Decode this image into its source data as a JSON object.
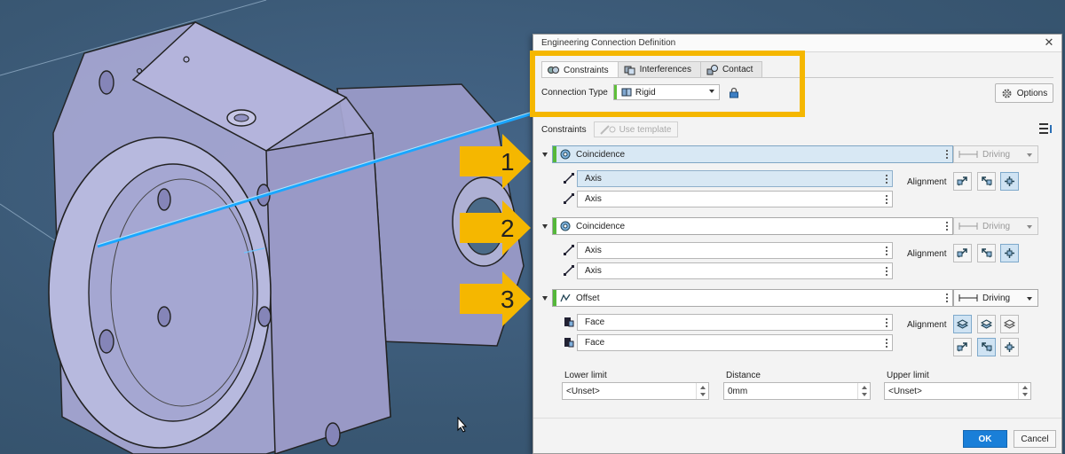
{
  "dialog": {
    "title": "Engineering Connection Definition",
    "close_glyph": "✕",
    "tabs": [
      {
        "label": "Constraints",
        "icon": "constraints-icon",
        "active": true
      },
      {
        "label": "Interferences",
        "icon": "interferences-icon",
        "active": false
      },
      {
        "label": "Contact",
        "icon": "contact-icon",
        "active": false
      }
    ],
    "connection_type_label": "Connection Type",
    "connection_type_value": "Rigid",
    "options_label": "Options",
    "constraints_label": "Constraints",
    "use_template_label": "Use template",
    "constraints": [
      {
        "type": "Coincidence",
        "driving": "Driving",
        "driving_enabled": false,
        "geometry": [
          "Axis",
          "Axis"
        ],
        "alignment_label": "Alignment"
      },
      {
        "type": "Coincidence",
        "driving": "Driving",
        "driving_enabled": false,
        "geometry": [
          "Axis",
          "Axis"
        ],
        "alignment_label": "Alignment"
      },
      {
        "type": "Offset",
        "driving": "Driving",
        "driving_enabled": true,
        "geometry": [
          "Face",
          "Face"
        ],
        "alignment_label": "Alignment"
      }
    ],
    "limits": {
      "lower_label": "Lower limit",
      "lower_value": "<Unset>",
      "distance_label": "Distance",
      "distance_value": "0mm",
      "upper_label": "Upper limit",
      "upper_value": "<Unset>"
    },
    "ok_label": "OK",
    "cancel_label": "Cancel"
  },
  "callouts": [
    "1",
    "2",
    "3"
  ],
  "colors": {
    "highlight": "#f5b700",
    "ok_button": "#1a7fd8",
    "active_bar": "#55b83a",
    "viewport_bg": "#3c5a74",
    "axis_line": "#38c8ff"
  }
}
